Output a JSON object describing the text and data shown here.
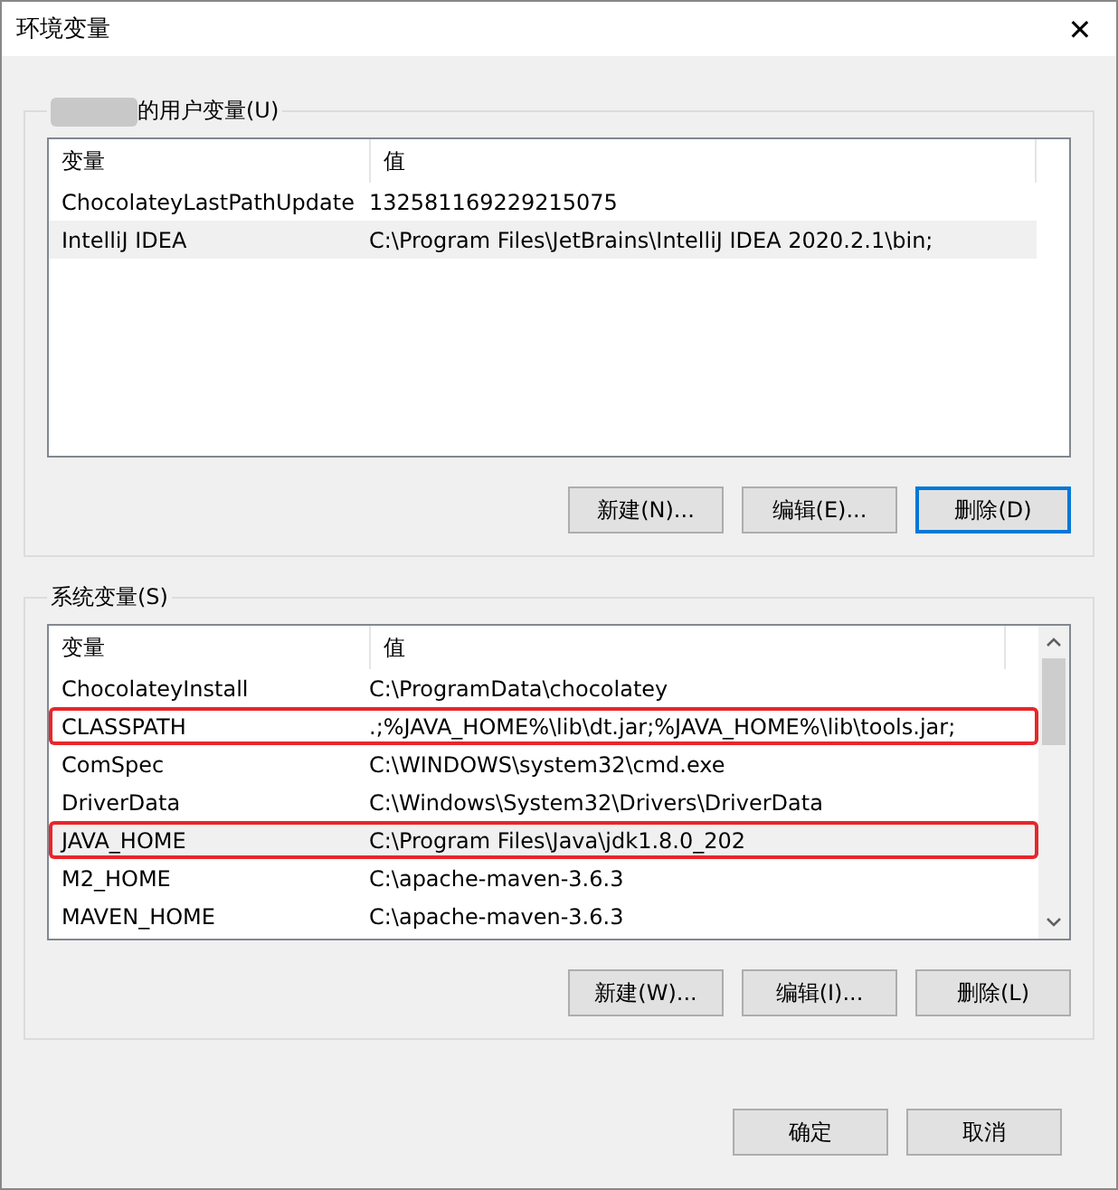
{
  "window": {
    "title": "环境变量",
    "close": "✕"
  },
  "user_group": {
    "label": "的用户变量(U)",
    "columns": [
      "变量",
      "值"
    ],
    "rows": [
      {
        "name": "ChocolateyLastPathUpdate",
        "value": "132581169229215075",
        "selected": false,
        "highlighted": false
      },
      {
        "name": "IntelliJ IDEA",
        "value": "C:\\Program Files\\JetBrains\\IntelliJ IDEA 2020.2.1\\bin;",
        "selected": true,
        "highlighted": false
      }
    ],
    "buttons": [
      {
        "label": "新建(N)...",
        "default": false
      },
      {
        "label": "编辑(E)...",
        "default": false
      },
      {
        "label": "删除(D)",
        "default": true
      }
    ]
  },
  "system_group": {
    "label": "系统变量(S)",
    "columns": [
      "变量",
      "值"
    ],
    "rows": [
      {
        "name": "ChocolateyInstall",
        "value": "C:\\ProgramData\\chocolatey",
        "selected": false,
        "highlighted": false
      },
      {
        "name": "CLASSPATH",
        "value": ".;%JAVA_HOME%\\lib\\dt.jar;%JAVA_HOME%\\lib\\tools.jar;",
        "selected": false,
        "highlighted": true
      },
      {
        "name": "ComSpec",
        "value": "C:\\WINDOWS\\system32\\cmd.exe",
        "selected": false,
        "highlighted": false
      },
      {
        "name": "DriverData",
        "value": "C:\\Windows\\System32\\Drivers\\DriverData",
        "selected": false,
        "highlighted": false
      },
      {
        "name": "JAVA_HOME",
        "value": "C:\\Program Files\\Java\\jdk1.8.0_202",
        "selected": true,
        "highlighted": true
      },
      {
        "name": "M2_HOME",
        "value": "C:\\apache-maven-3.6.3",
        "selected": false,
        "highlighted": false
      },
      {
        "name": "MAVEN_HOME",
        "value": "C:\\apache-maven-3.6.3",
        "selected": false,
        "highlighted": false
      }
    ],
    "buttons": [
      {
        "label": "新建(W)...",
        "default": false
      },
      {
        "label": "编辑(I)...",
        "default": false
      },
      {
        "label": "删除(L)",
        "default": false
      }
    ]
  },
  "footer_buttons": [
    {
      "label": "确定",
      "default": false
    },
    {
      "label": "取消",
      "default": false
    }
  ]
}
